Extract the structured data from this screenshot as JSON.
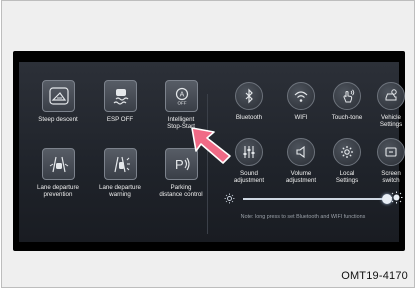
{
  "left_controls": [
    {
      "label": "Steep descent",
      "icon": "hill-descent-icon"
    },
    {
      "label": "ESP OFF",
      "icon": "esp-off-icon"
    },
    {
      "label": "Intelligent\nStop-Start",
      "icon": "auto-stop-start-icon",
      "icon_text": "OFF"
    },
    {
      "label": "Lane departure\nprevention",
      "icon": "lane-prevention-icon"
    },
    {
      "label": "Lane departure\nwarning",
      "icon": "lane-warning-icon"
    },
    {
      "label": "Parking\ndistance control",
      "icon": "parking-sensor-icon",
      "icon_text": "P"
    }
  ],
  "right_controls": [
    {
      "label": "Bluetooth",
      "icon": "bluetooth-icon"
    },
    {
      "label": "WIFI",
      "icon": "wifi-icon"
    },
    {
      "label": "Touch-tone",
      "icon": "touch-tone-icon"
    },
    {
      "label": "Vehicle\nSettings",
      "icon": "vehicle-settings-icon"
    },
    {
      "label": "Sound\nadjustment",
      "icon": "sound-adjustment-icon"
    },
    {
      "label": "Volume\nadjustment",
      "icon": "volume-icon"
    },
    {
      "label": "Local\nSettings",
      "icon": "local-settings-icon"
    },
    {
      "label": "Screen\nswitch",
      "icon": "screen-switch-icon"
    }
  ],
  "brightness": {
    "level": 0.97,
    "icon_low": "sun-small-icon",
    "icon_high": "sun-large-icon"
  },
  "note": "Note: long press to set Bluetooth and WIFI functions",
  "caption": "OMT19-4170",
  "colors": {
    "pointer": "#f06a86",
    "slider": "#cfd8e3"
  }
}
